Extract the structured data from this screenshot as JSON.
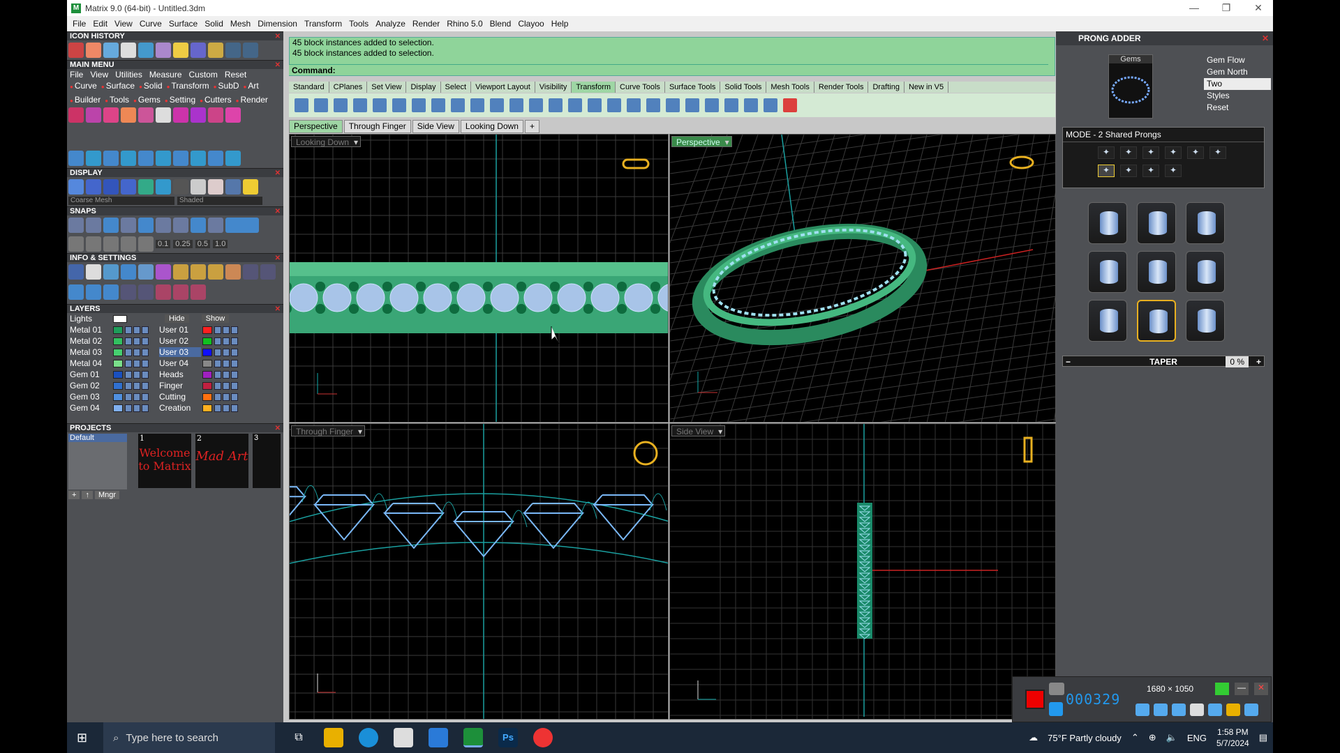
{
  "window": {
    "title": "Matrix 9.0 (64-bit) - Untitled.3dm"
  },
  "menubar": [
    "File",
    "Edit",
    "View",
    "Curve",
    "Surface",
    "Solid",
    "Mesh",
    "Dimension",
    "Transform",
    "Tools",
    "Analyze",
    "Render",
    "Rhino 5.0",
    "Blend",
    "Clayoo",
    "Help"
  ],
  "left": {
    "icon_history": "ICON HISTORY",
    "main_menu": "MAIN MENU",
    "main_menu_row": [
      "File",
      "View",
      "Utilities",
      "Measure",
      "Custom",
      "Reset"
    ],
    "main_menu_tabs": [
      "Curve",
      "Surface",
      "Solid",
      "Transform",
      "SubD",
      "Art",
      "Builder",
      "Tools",
      "Gems",
      "Setting",
      "Cutters",
      "Render"
    ],
    "display": "DISPLAY",
    "display_select1": "Coarse Mesh",
    "display_select2": "Shaded",
    "snaps": "SNAPS",
    "snap_values": [
      "0.1",
      "0.25",
      "0.5",
      "1.0"
    ],
    "info": "INFO & SETTINGS",
    "layers": "LAYERS",
    "lights": "Lights",
    "hide": "Hide",
    "show": "Show",
    "layer_rows": [
      {
        "name": "Metal 01",
        "color": "#1e9e5a",
        "name2": "User 01",
        "color2": "#ff2020"
      },
      {
        "name": "Metal 02",
        "color": "#32c060",
        "name2": "User 02",
        "color2": "#10c020"
      },
      {
        "name": "Metal 03",
        "color": "#46d070",
        "name2": "User 03",
        "color2": "#1010ff"
      },
      {
        "name": "Metal 04",
        "color": "#7ae08a",
        "name2": "User 04",
        "color2": "#888888"
      },
      {
        "name": "Gem 01",
        "color": "#1a50c0",
        "name2": "Heads",
        "color2": "#a020c0"
      },
      {
        "name": "Gem 02",
        "color": "#3070d0",
        "name2": "Finger",
        "color2": "#c02040"
      },
      {
        "name": "Gem 03",
        "color": "#5090e0",
        "name2": "Cutting",
        "color2": "#ff7010"
      },
      {
        "name": "Gem 04",
        "color": "#80b0f0",
        "name2": "Creation",
        "color2": "#ffb020"
      }
    ],
    "projects": "PROJECTS",
    "project_default": "Default",
    "project_nums": [
      "1",
      "2",
      "3"
    ],
    "project1_text": "Welcome to Matrix",
    "project2_text": "Mad Art",
    "mngr": "Mngr"
  },
  "command": {
    "history": [
      "45 block instances added to selection.",
      "45 block instances added to selection."
    ],
    "prompt": "Command:"
  },
  "toolbar_tabs": [
    "Standard",
    "CPlanes",
    "Set View",
    "Display",
    "Select",
    "Viewport Layout",
    "Visibility",
    "Transform",
    "Curve Tools",
    "Surface Tools",
    "Solid Tools",
    "Mesh Tools",
    "Render Tools",
    "Drafting",
    "New in V5"
  ],
  "toolbar_active": "Transform",
  "view_tabs": [
    "Perspective",
    "Through Finger",
    "Side View",
    "Looking Down"
  ],
  "viewports": {
    "top_left": "Looking Down",
    "top_right": "Perspective",
    "bottom_left": "Through Finger",
    "bottom_right": "Side View"
  },
  "right": {
    "title": "PRONG ADDER",
    "gems_label": "Gems",
    "options": [
      "Gem Flow",
      "Gem North",
      "Two",
      "Styles",
      "Reset"
    ],
    "mode": "MODE - 2 Shared Prongs",
    "taper_label": "TAPER",
    "taper_value": "0 %"
  },
  "recorder": {
    "time": "000329",
    "resolution": "1680 × 1050"
  },
  "taskbar": {
    "search_placeholder": "Type here to search",
    "weather": "75°F  Partly cloudy",
    "lang": "ENG",
    "time": "1:58 PM",
    "date": "5/7/2024"
  }
}
